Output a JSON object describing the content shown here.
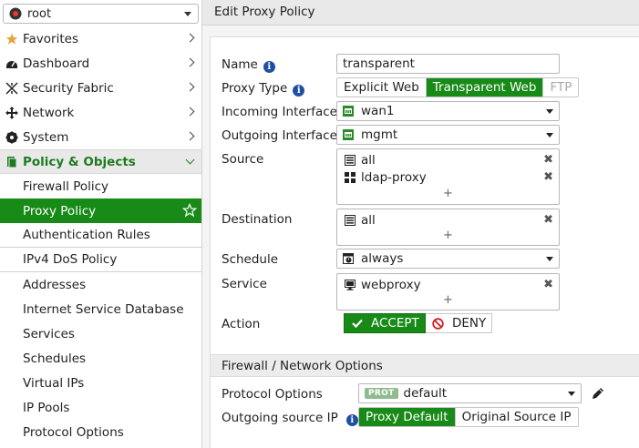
{
  "vdom": {
    "label": "root"
  },
  "nav": {
    "favorites": "Favorites",
    "dashboard": "Dashboard",
    "security_fabric": "Security Fabric",
    "network": "Network",
    "system": "System",
    "policy_objects": "Policy & Objects",
    "sub_items": [
      "Firewall Policy",
      "Proxy Policy",
      "Authentication Rules",
      "IPv4 DoS Policy",
      "Addresses",
      "Internet Service Database",
      "Services",
      "Schedules",
      "Virtual IPs",
      "IP Pools",
      "Protocol Options"
    ]
  },
  "header": {
    "title": "Edit Proxy Policy"
  },
  "form": {
    "name_label": "Name",
    "name_value": "transparent",
    "proxy_type_label": "Proxy Type",
    "proxy_type_options": [
      "Explicit Web",
      "Transparent Web",
      "FTP"
    ],
    "incoming_label": "Incoming Interface",
    "incoming_value": "wan1",
    "outgoing_label": "Outgoing Interface",
    "outgoing_value": "mgmt",
    "source_label": "Source",
    "source_values": [
      "all",
      "ldap-proxy"
    ],
    "destination_label": "Destination",
    "destination_values": [
      "all"
    ],
    "schedule_label": "Schedule",
    "schedule_value": "always",
    "service_label": "Service",
    "service_values": [
      "webproxy"
    ],
    "action_label": "Action",
    "accept_label": "ACCEPT",
    "deny_label": "DENY",
    "plus": "+",
    "remove": "✖"
  },
  "firewall_section": {
    "title": "Firewall / Network Options",
    "protocol_label": "Protocol Options",
    "protocol_badge": "PROT",
    "protocol_value": "default",
    "outgoing_ip_label": "Outgoing source IP",
    "outgoing_ip_options": [
      "Proxy Default",
      "Original Source IP"
    ]
  },
  "colors": {
    "accent": "#178a17",
    "info": "#1f4fa3"
  }
}
